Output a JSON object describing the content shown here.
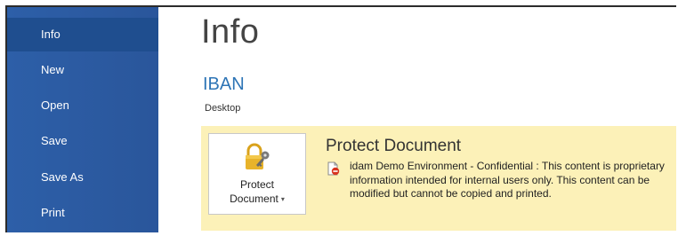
{
  "sidebar": {
    "items": [
      {
        "label": "Info",
        "active": true
      },
      {
        "label": "New",
        "active": false
      },
      {
        "label": "Open",
        "active": false
      },
      {
        "label": "Save",
        "active": false
      },
      {
        "label": "Save As",
        "active": false
      },
      {
        "label": "Print",
        "active": false
      }
    ]
  },
  "main": {
    "title": "Info",
    "document_name": "IBAN",
    "document_location": "Desktop",
    "protect": {
      "button_line1": "Protect",
      "button_line2": "Document",
      "button_caret": "▾",
      "button_icon": "lock-key-icon",
      "heading": "Protect Document",
      "warning_icon": "restricted-document-icon",
      "description": "idam Demo Environment - Confidential : This content is proprietary information intended for internal users only. This content can be modified but cannot be copied and printed."
    }
  },
  "colors": {
    "sidebar_bg": "#2b579a",
    "sidebar_active": "#1f4e8f",
    "doc_name": "#2e75b6",
    "panel_bg": "#fcf1b8"
  }
}
